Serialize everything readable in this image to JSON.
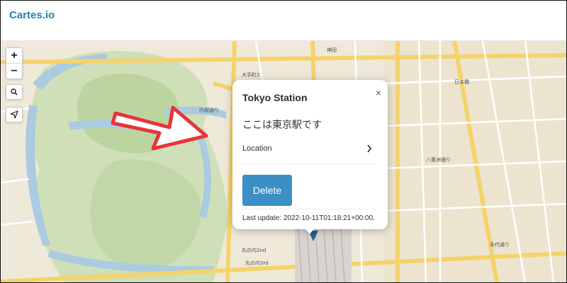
{
  "app": {
    "brand": "Cartes.io"
  },
  "map_controls": {
    "zoom_in_label": "+",
    "zoom_out_label": "−",
    "search_icon": "search-icon",
    "locate_icon": "navigation-arrow-icon"
  },
  "popup": {
    "close_label": "×",
    "title": "Tokyo Station",
    "description": "ここは東京駅です",
    "location_label": "Location",
    "delete_label": "Delete",
    "last_update": "Last update: 2022-10-11T01:18:21+00:00."
  },
  "annotation": {
    "arrow_color": "#e8343a"
  },
  "map_labels": {
    "label_1": "大手町2",
    "label_2": "丸の内2nd",
    "label_3": "丸の内3rd",
    "label_4": "内堀通り",
    "label_5": "永代通り",
    "label_6": "日本橋",
    "label_7": "八重洲通り",
    "label_8": "神田"
  }
}
